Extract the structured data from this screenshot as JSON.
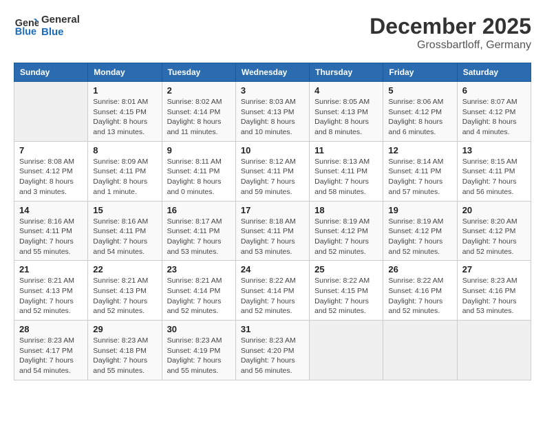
{
  "header": {
    "logo_line1": "General",
    "logo_line2": "Blue",
    "month": "December 2025",
    "location": "Grossbartloff, Germany"
  },
  "weekdays": [
    "Sunday",
    "Monday",
    "Tuesday",
    "Wednesday",
    "Thursday",
    "Friday",
    "Saturday"
  ],
  "weeks": [
    [
      {
        "day": "",
        "sunrise": "",
        "sunset": "",
        "daylight": ""
      },
      {
        "day": "1",
        "sunrise": "Sunrise: 8:01 AM",
        "sunset": "Sunset: 4:15 PM",
        "daylight": "Daylight: 8 hours and 13 minutes."
      },
      {
        "day": "2",
        "sunrise": "Sunrise: 8:02 AM",
        "sunset": "Sunset: 4:14 PM",
        "daylight": "Daylight: 8 hours and 11 minutes."
      },
      {
        "day": "3",
        "sunrise": "Sunrise: 8:03 AM",
        "sunset": "Sunset: 4:13 PM",
        "daylight": "Daylight: 8 hours and 10 minutes."
      },
      {
        "day": "4",
        "sunrise": "Sunrise: 8:05 AM",
        "sunset": "Sunset: 4:13 PM",
        "daylight": "Daylight: 8 hours and 8 minutes."
      },
      {
        "day": "5",
        "sunrise": "Sunrise: 8:06 AM",
        "sunset": "Sunset: 4:12 PM",
        "daylight": "Daylight: 8 hours and 6 minutes."
      },
      {
        "day": "6",
        "sunrise": "Sunrise: 8:07 AM",
        "sunset": "Sunset: 4:12 PM",
        "daylight": "Daylight: 8 hours and 4 minutes."
      }
    ],
    [
      {
        "day": "7",
        "sunrise": "Sunrise: 8:08 AM",
        "sunset": "Sunset: 4:12 PM",
        "daylight": "Daylight: 8 hours and 3 minutes."
      },
      {
        "day": "8",
        "sunrise": "Sunrise: 8:09 AM",
        "sunset": "Sunset: 4:11 PM",
        "daylight": "Daylight: 8 hours and 1 minute."
      },
      {
        "day": "9",
        "sunrise": "Sunrise: 8:11 AM",
        "sunset": "Sunset: 4:11 PM",
        "daylight": "Daylight: 8 hours and 0 minutes."
      },
      {
        "day": "10",
        "sunrise": "Sunrise: 8:12 AM",
        "sunset": "Sunset: 4:11 PM",
        "daylight": "Daylight: 7 hours and 59 minutes."
      },
      {
        "day": "11",
        "sunrise": "Sunrise: 8:13 AM",
        "sunset": "Sunset: 4:11 PM",
        "daylight": "Daylight: 7 hours and 58 minutes."
      },
      {
        "day": "12",
        "sunrise": "Sunrise: 8:14 AM",
        "sunset": "Sunset: 4:11 PM",
        "daylight": "Daylight: 7 hours and 57 minutes."
      },
      {
        "day": "13",
        "sunrise": "Sunrise: 8:15 AM",
        "sunset": "Sunset: 4:11 PM",
        "daylight": "Daylight: 7 hours and 56 minutes."
      }
    ],
    [
      {
        "day": "14",
        "sunrise": "Sunrise: 8:16 AM",
        "sunset": "Sunset: 4:11 PM",
        "daylight": "Daylight: 7 hours and 55 minutes."
      },
      {
        "day": "15",
        "sunrise": "Sunrise: 8:16 AM",
        "sunset": "Sunset: 4:11 PM",
        "daylight": "Daylight: 7 hours and 54 minutes."
      },
      {
        "day": "16",
        "sunrise": "Sunrise: 8:17 AM",
        "sunset": "Sunset: 4:11 PM",
        "daylight": "Daylight: 7 hours and 53 minutes."
      },
      {
        "day": "17",
        "sunrise": "Sunrise: 8:18 AM",
        "sunset": "Sunset: 4:11 PM",
        "daylight": "Daylight: 7 hours and 53 minutes."
      },
      {
        "day": "18",
        "sunrise": "Sunrise: 8:19 AM",
        "sunset": "Sunset: 4:12 PM",
        "daylight": "Daylight: 7 hours and 52 minutes."
      },
      {
        "day": "19",
        "sunrise": "Sunrise: 8:19 AM",
        "sunset": "Sunset: 4:12 PM",
        "daylight": "Daylight: 7 hours and 52 minutes."
      },
      {
        "day": "20",
        "sunrise": "Sunrise: 8:20 AM",
        "sunset": "Sunset: 4:12 PM",
        "daylight": "Daylight: 7 hours and 52 minutes."
      }
    ],
    [
      {
        "day": "21",
        "sunrise": "Sunrise: 8:21 AM",
        "sunset": "Sunset: 4:13 PM",
        "daylight": "Daylight: 7 hours and 52 minutes."
      },
      {
        "day": "22",
        "sunrise": "Sunrise: 8:21 AM",
        "sunset": "Sunset: 4:13 PM",
        "daylight": "Daylight: 7 hours and 52 minutes."
      },
      {
        "day": "23",
        "sunrise": "Sunrise: 8:21 AM",
        "sunset": "Sunset: 4:14 PM",
        "daylight": "Daylight: 7 hours and 52 minutes."
      },
      {
        "day": "24",
        "sunrise": "Sunrise: 8:22 AM",
        "sunset": "Sunset: 4:14 PM",
        "daylight": "Daylight: 7 hours and 52 minutes."
      },
      {
        "day": "25",
        "sunrise": "Sunrise: 8:22 AM",
        "sunset": "Sunset: 4:15 PM",
        "daylight": "Daylight: 7 hours and 52 minutes."
      },
      {
        "day": "26",
        "sunrise": "Sunrise: 8:22 AM",
        "sunset": "Sunset: 4:16 PM",
        "daylight": "Daylight: 7 hours and 52 minutes."
      },
      {
        "day": "27",
        "sunrise": "Sunrise: 8:23 AM",
        "sunset": "Sunset: 4:16 PM",
        "daylight": "Daylight: 7 hours and 53 minutes."
      }
    ],
    [
      {
        "day": "28",
        "sunrise": "Sunrise: 8:23 AM",
        "sunset": "Sunset: 4:17 PM",
        "daylight": "Daylight: 7 hours and 54 minutes."
      },
      {
        "day": "29",
        "sunrise": "Sunrise: 8:23 AM",
        "sunset": "Sunset: 4:18 PM",
        "daylight": "Daylight: 7 hours and 55 minutes."
      },
      {
        "day": "30",
        "sunrise": "Sunrise: 8:23 AM",
        "sunset": "Sunset: 4:19 PM",
        "daylight": "Daylight: 7 hours and 55 minutes."
      },
      {
        "day": "31",
        "sunrise": "Sunrise: 8:23 AM",
        "sunset": "Sunset: 4:20 PM",
        "daylight": "Daylight: 7 hours and 56 minutes."
      },
      {
        "day": "",
        "sunrise": "",
        "sunset": "",
        "daylight": ""
      },
      {
        "day": "",
        "sunrise": "",
        "sunset": "",
        "daylight": ""
      },
      {
        "day": "",
        "sunrise": "",
        "sunset": "",
        "daylight": ""
      }
    ]
  ]
}
